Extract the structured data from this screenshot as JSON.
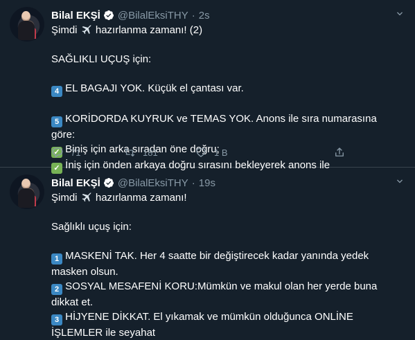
{
  "tweets": [
    {
      "author": "Bilal EKŞİ",
      "handle": "@BilalEksiTHY",
      "time": "2s",
      "line1_pre": "Şimdi",
      "line1_post": "hazırlanma zamanı! (2)",
      "subtitle": "SAĞLIKLI UÇUŞ için:",
      "items": [
        {
          "key": "4",
          "text": "EL BAGAJI YOK. Küçük el çantası var."
        },
        {
          "key": "5",
          "text": "KORİDORDA KUYRUK ve TEMAS YOK. Anons ile sıra numarasına göre:"
        }
      ],
      "checks": [
        "Biniş için arka sıradan öne doğru;",
        "İniş için önden arkaya doğru sırasını bekleyerek anons ile"
      ],
      "replies": "71",
      "retweets": "181",
      "likes": "1 B"
    },
    {
      "author": "Bilal EKŞİ",
      "handle": "@BilalEksiTHY",
      "time": "19s",
      "line1_pre": "Şimdi",
      "line1_post": "hazırlanma zamanı!",
      "subtitle": "Sağlıklı uçuş için:",
      "items": [
        {
          "key": "1",
          "text": "MASKENİ TAK. Her 4 saatte bir değiştirecek kadar yanında yedek masken olsun."
        },
        {
          "key": "2",
          "text": "SOSYAL MESAFENİ KORU:Mümkün ve makul  olan her yerde buna dikkat et."
        },
        {
          "key": "3",
          "text": "HİJYENE DİKKAT. El yıkamak ve mümkün olduğunca  ONLİNE İŞLEMLER ile seyahat"
        }
      ]
    }
  ],
  "icons": {
    "verified": "verified-badge-icon",
    "chevron": "chevron-down-icon",
    "plane": "airplane-emoji-icon",
    "reply": "reply-icon",
    "retweet": "retweet-icon",
    "like": "heart-icon",
    "share": "share-icon"
  },
  "colors": {
    "background": "#15202b",
    "secondary_text": "#8899a6",
    "accent": "#1da1f2",
    "keycap": "#3b88c3",
    "checkmark": "#77b255"
  }
}
